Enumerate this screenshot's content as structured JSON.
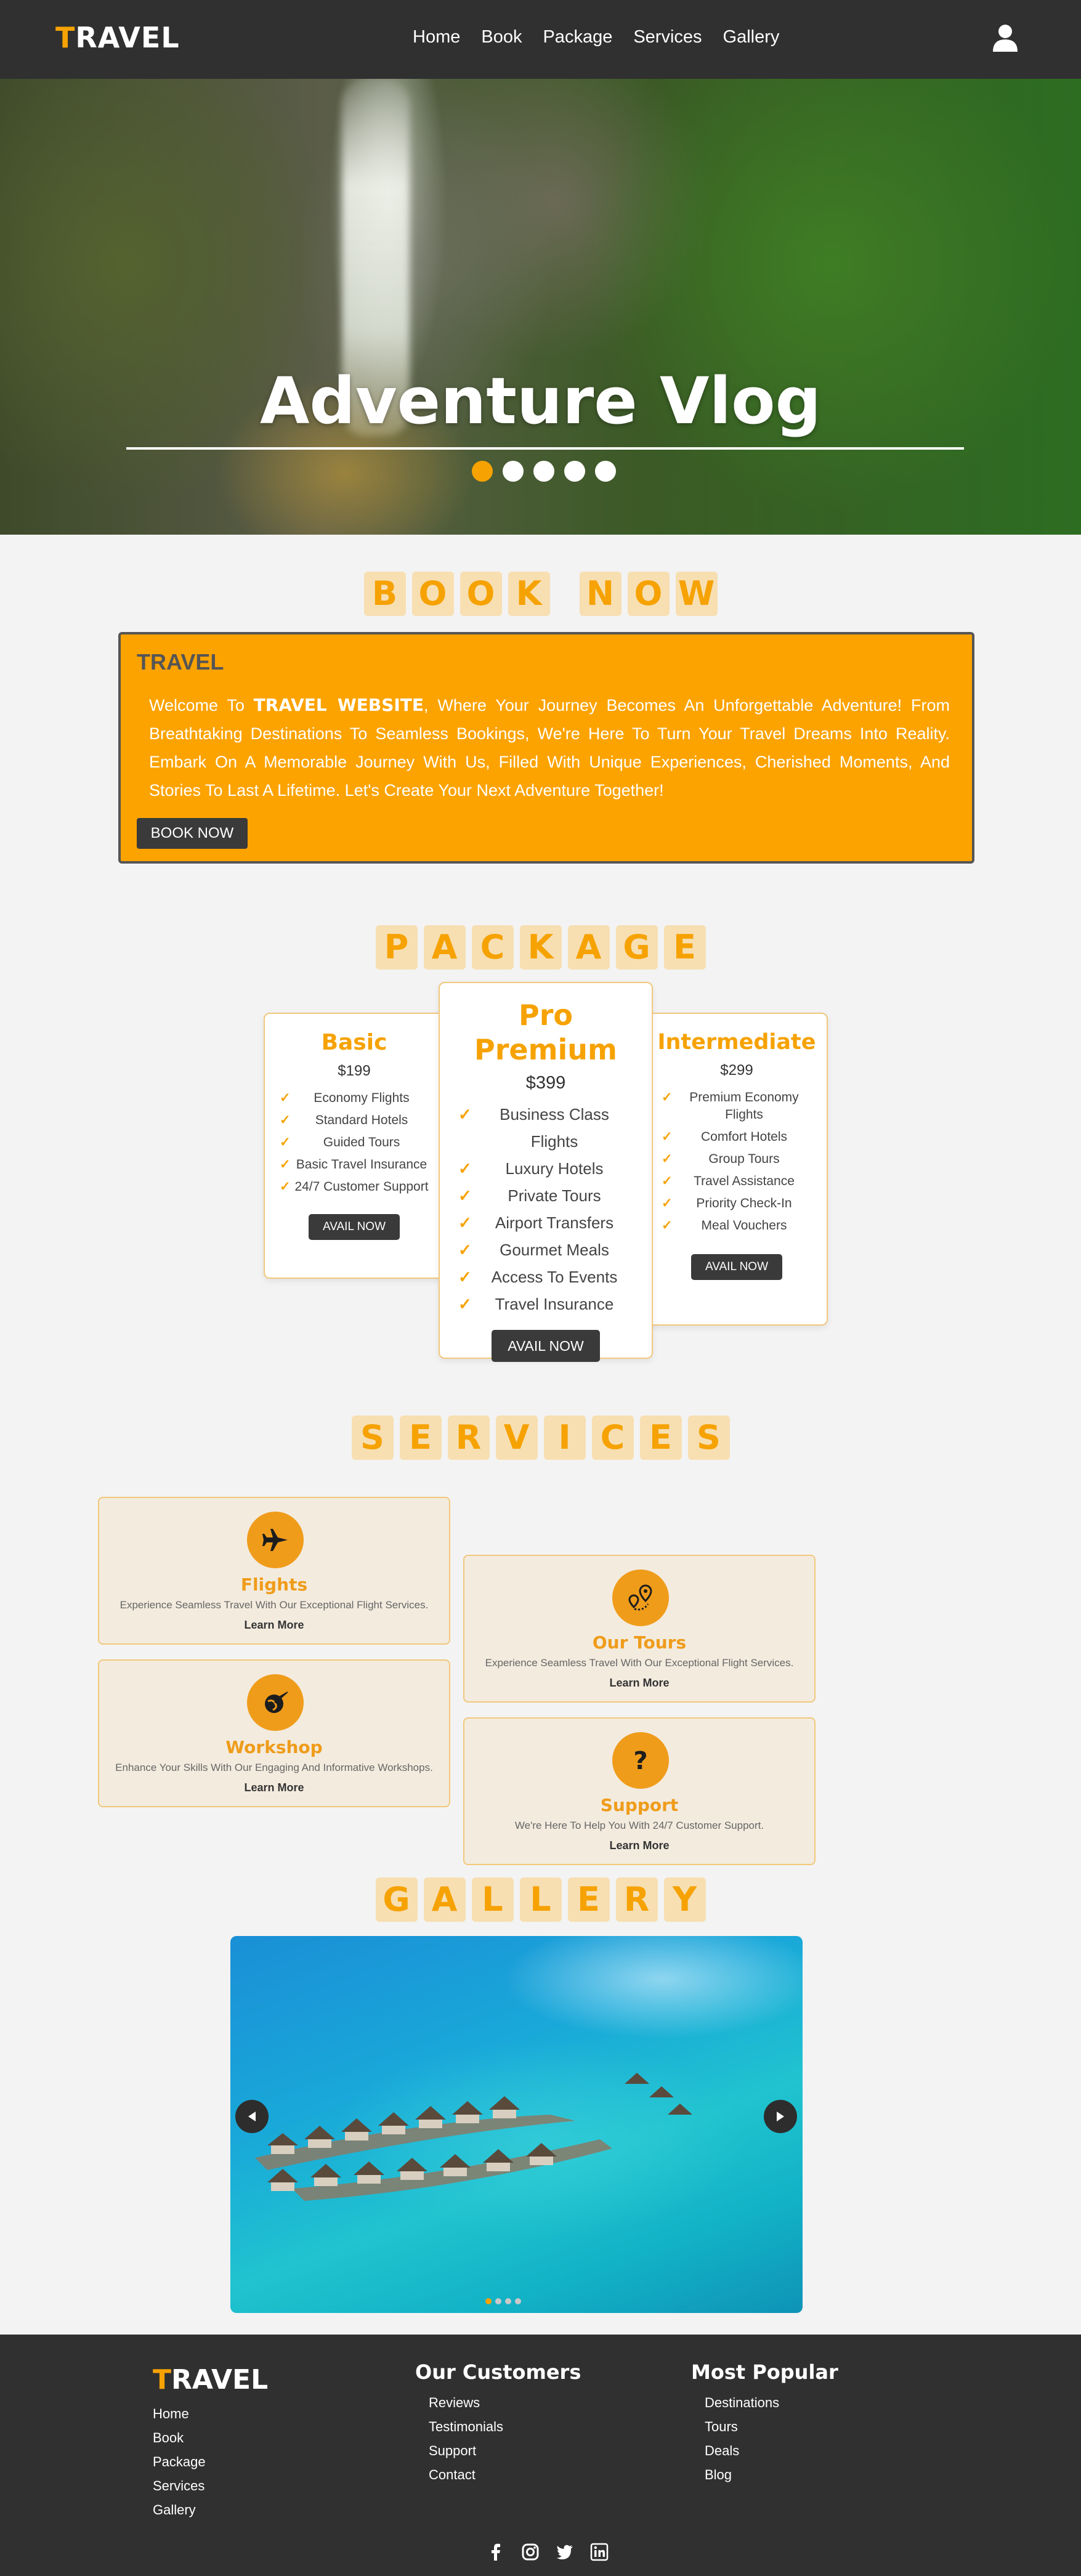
{
  "nav": {
    "logo_first": "T",
    "logo_rest": "RAVEL",
    "links": [
      "Home",
      "Book",
      "Package",
      "Services",
      "Gallery"
    ],
    "user_icon": "user-icon"
  },
  "hero": {
    "title": "Adventure Vlog",
    "slides": 5,
    "active_slide": 1
  },
  "book": {
    "section_letters": [
      "B",
      "O",
      "O",
      "K",
      "",
      "N",
      "O",
      "W"
    ],
    "brand": "TRAVEL",
    "text_pre": "Welcome To ",
    "text_bold": "TRAVEL WEBSITE",
    "text_post": ", Where Your Journey Becomes An Unforgettable Adventure! From Breathtaking Destinations To Seamless Bookings, We're Here To Turn Your Travel Dreams Into Reality. Embark On A Memorable Journey With Us, Filled With Unique Experiences, Cherished Moments, And Stories To Last A Lifetime. Let's Create Your Next Adventure Together!",
    "button": "BOOK NOW"
  },
  "packages": {
    "section_letters": [
      "P",
      "A",
      "C",
      "K",
      "A",
      "G",
      "E"
    ],
    "cards": [
      {
        "title": "Basic",
        "price": "$199",
        "features": [
          "Economy Flights",
          "Standard Hotels",
          "Guided Tours",
          "Basic Travel Insurance",
          "24/7 Customer Support"
        ],
        "button": "AVAIL NOW"
      },
      {
        "title": "Pro Premium",
        "price": "$399",
        "features": [
          "Business Class Flights",
          "Luxury Hotels",
          "Private Tours",
          "Airport Transfers",
          "Gourmet Meals",
          "Access To Events",
          "Travel Insurance"
        ],
        "button": "AVAIL NOW"
      },
      {
        "title": "Intermediate",
        "price": "$299",
        "features": [
          "Premium Economy Flights",
          "Comfort Hotels",
          "Group Tours",
          "Travel Assistance",
          "Priority Check-In",
          "Meal Vouchers"
        ],
        "button": "AVAIL NOW"
      }
    ]
  },
  "services": {
    "section_letters": [
      "S",
      "E",
      "R",
      "V",
      "I",
      "C",
      "E",
      "S"
    ],
    "items": [
      {
        "title": "Flights",
        "desc": "Experience Seamless Travel With Our Exceptional Flight Services.",
        "link": "Learn More",
        "icon": "plane-icon"
      },
      {
        "title": "Our Tours",
        "desc": "Experience Seamless Travel With Our Exceptional Flight Services.",
        "link": "Learn More",
        "icon": "map-pin-icon"
      },
      {
        "title": "Workshop",
        "desc": "Enhance Your Skills With Our Engaging And Informative Workshops.",
        "link": "Learn More",
        "icon": "globe-plane-icon"
      },
      {
        "title": "Support",
        "desc": "We're Here To Help You With 24/7 Customer Support.",
        "link": "Learn More",
        "icon": "question-icon"
      }
    ]
  },
  "gallery": {
    "section_letters": [
      "G",
      "A",
      "L",
      "L",
      "E",
      "R",
      "Y"
    ],
    "slides": 4,
    "active_slide": 1
  },
  "footer": {
    "logo_first": "T",
    "logo_rest": "RAVEL",
    "links": [
      "Home",
      "Book",
      "Package",
      "Services",
      "Gallery"
    ],
    "customers_title": "Our Customers",
    "customers": [
      "Reviews",
      "Testimonials",
      "Support",
      "Contact"
    ],
    "popular_title": "Most Popular",
    "popular": [
      "Destinations",
      "Tours",
      "Deals",
      "Blog"
    ],
    "socials": [
      "facebook-icon",
      "instagram-icon",
      "twitter-icon",
      "linkedin-icon"
    ]
  },
  "colors": {
    "accent": "#f6a202",
    "dark": "#303030",
    "card_border": "#f2c87c",
    "service_bg": "#f3ebde"
  }
}
